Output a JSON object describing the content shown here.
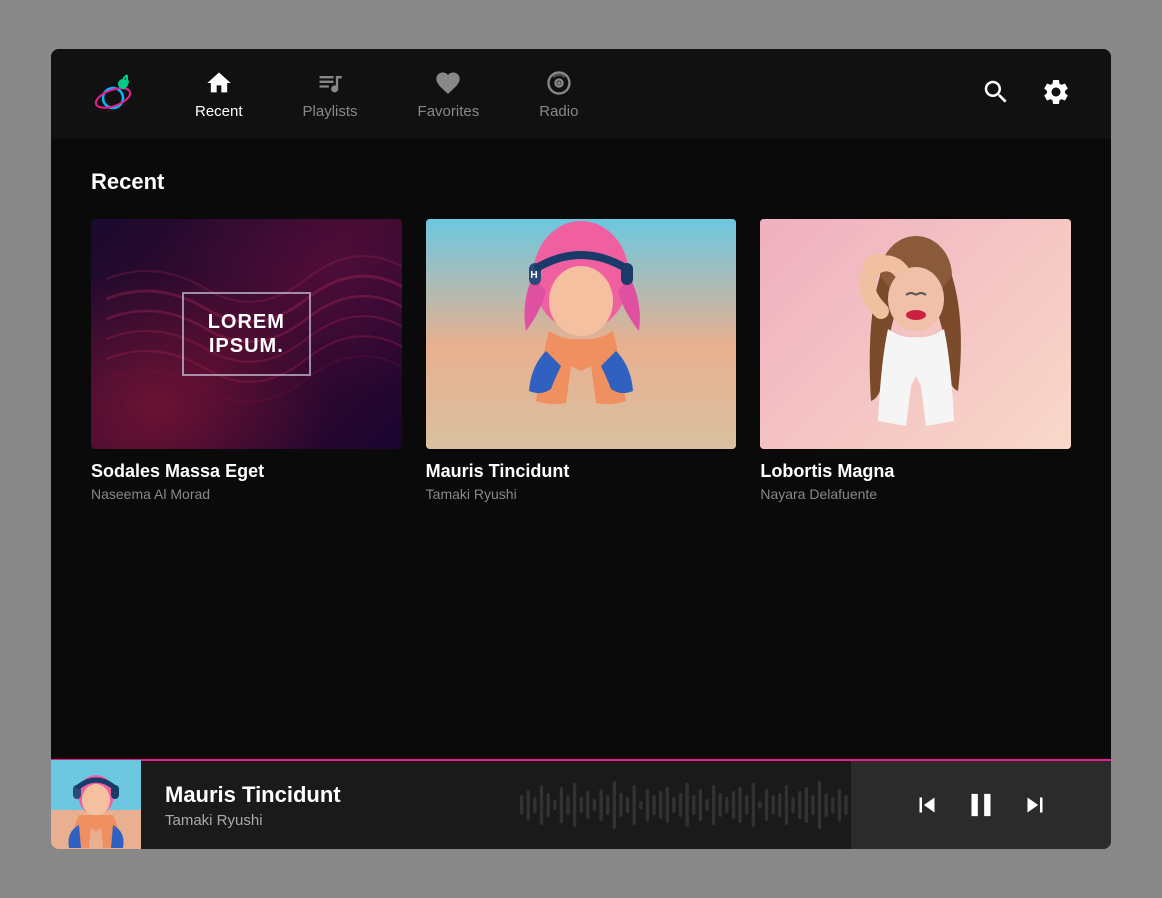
{
  "app": {
    "title": "Music App"
  },
  "nav": {
    "items": [
      {
        "id": "recent",
        "label": "Recent",
        "active": true
      },
      {
        "id": "playlists",
        "label": "Playlists",
        "active": false
      },
      {
        "id": "favorites",
        "label": "Favorites",
        "active": false
      },
      {
        "id": "radio",
        "label": "Radio",
        "active": false
      }
    ]
  },
  "main": {
    "section_title": "Recent",
    "cards": [
      {
        "id": "card1",
        "title": "Sodales Massa Eget",
        "subtitle": "Naseema Al Morad",
        "image_text_line1": "LOREM",
        "image_text_line2": "IPSUM."
      },
      {
        "id": "card2",
        "title": "Mauris Tincidunt",
        "subtitle": "Tamaki Ryushi"
      },
      {
        "id": "card3",
        "title": "Lobortis Magna",
        "subtitle": "Nayara Delafuente"
      }
    ]
  },
  "player": {
    "title": "Mauris Tincidunt",
    "artist": "Tamaki Ryushi"
  }
}
